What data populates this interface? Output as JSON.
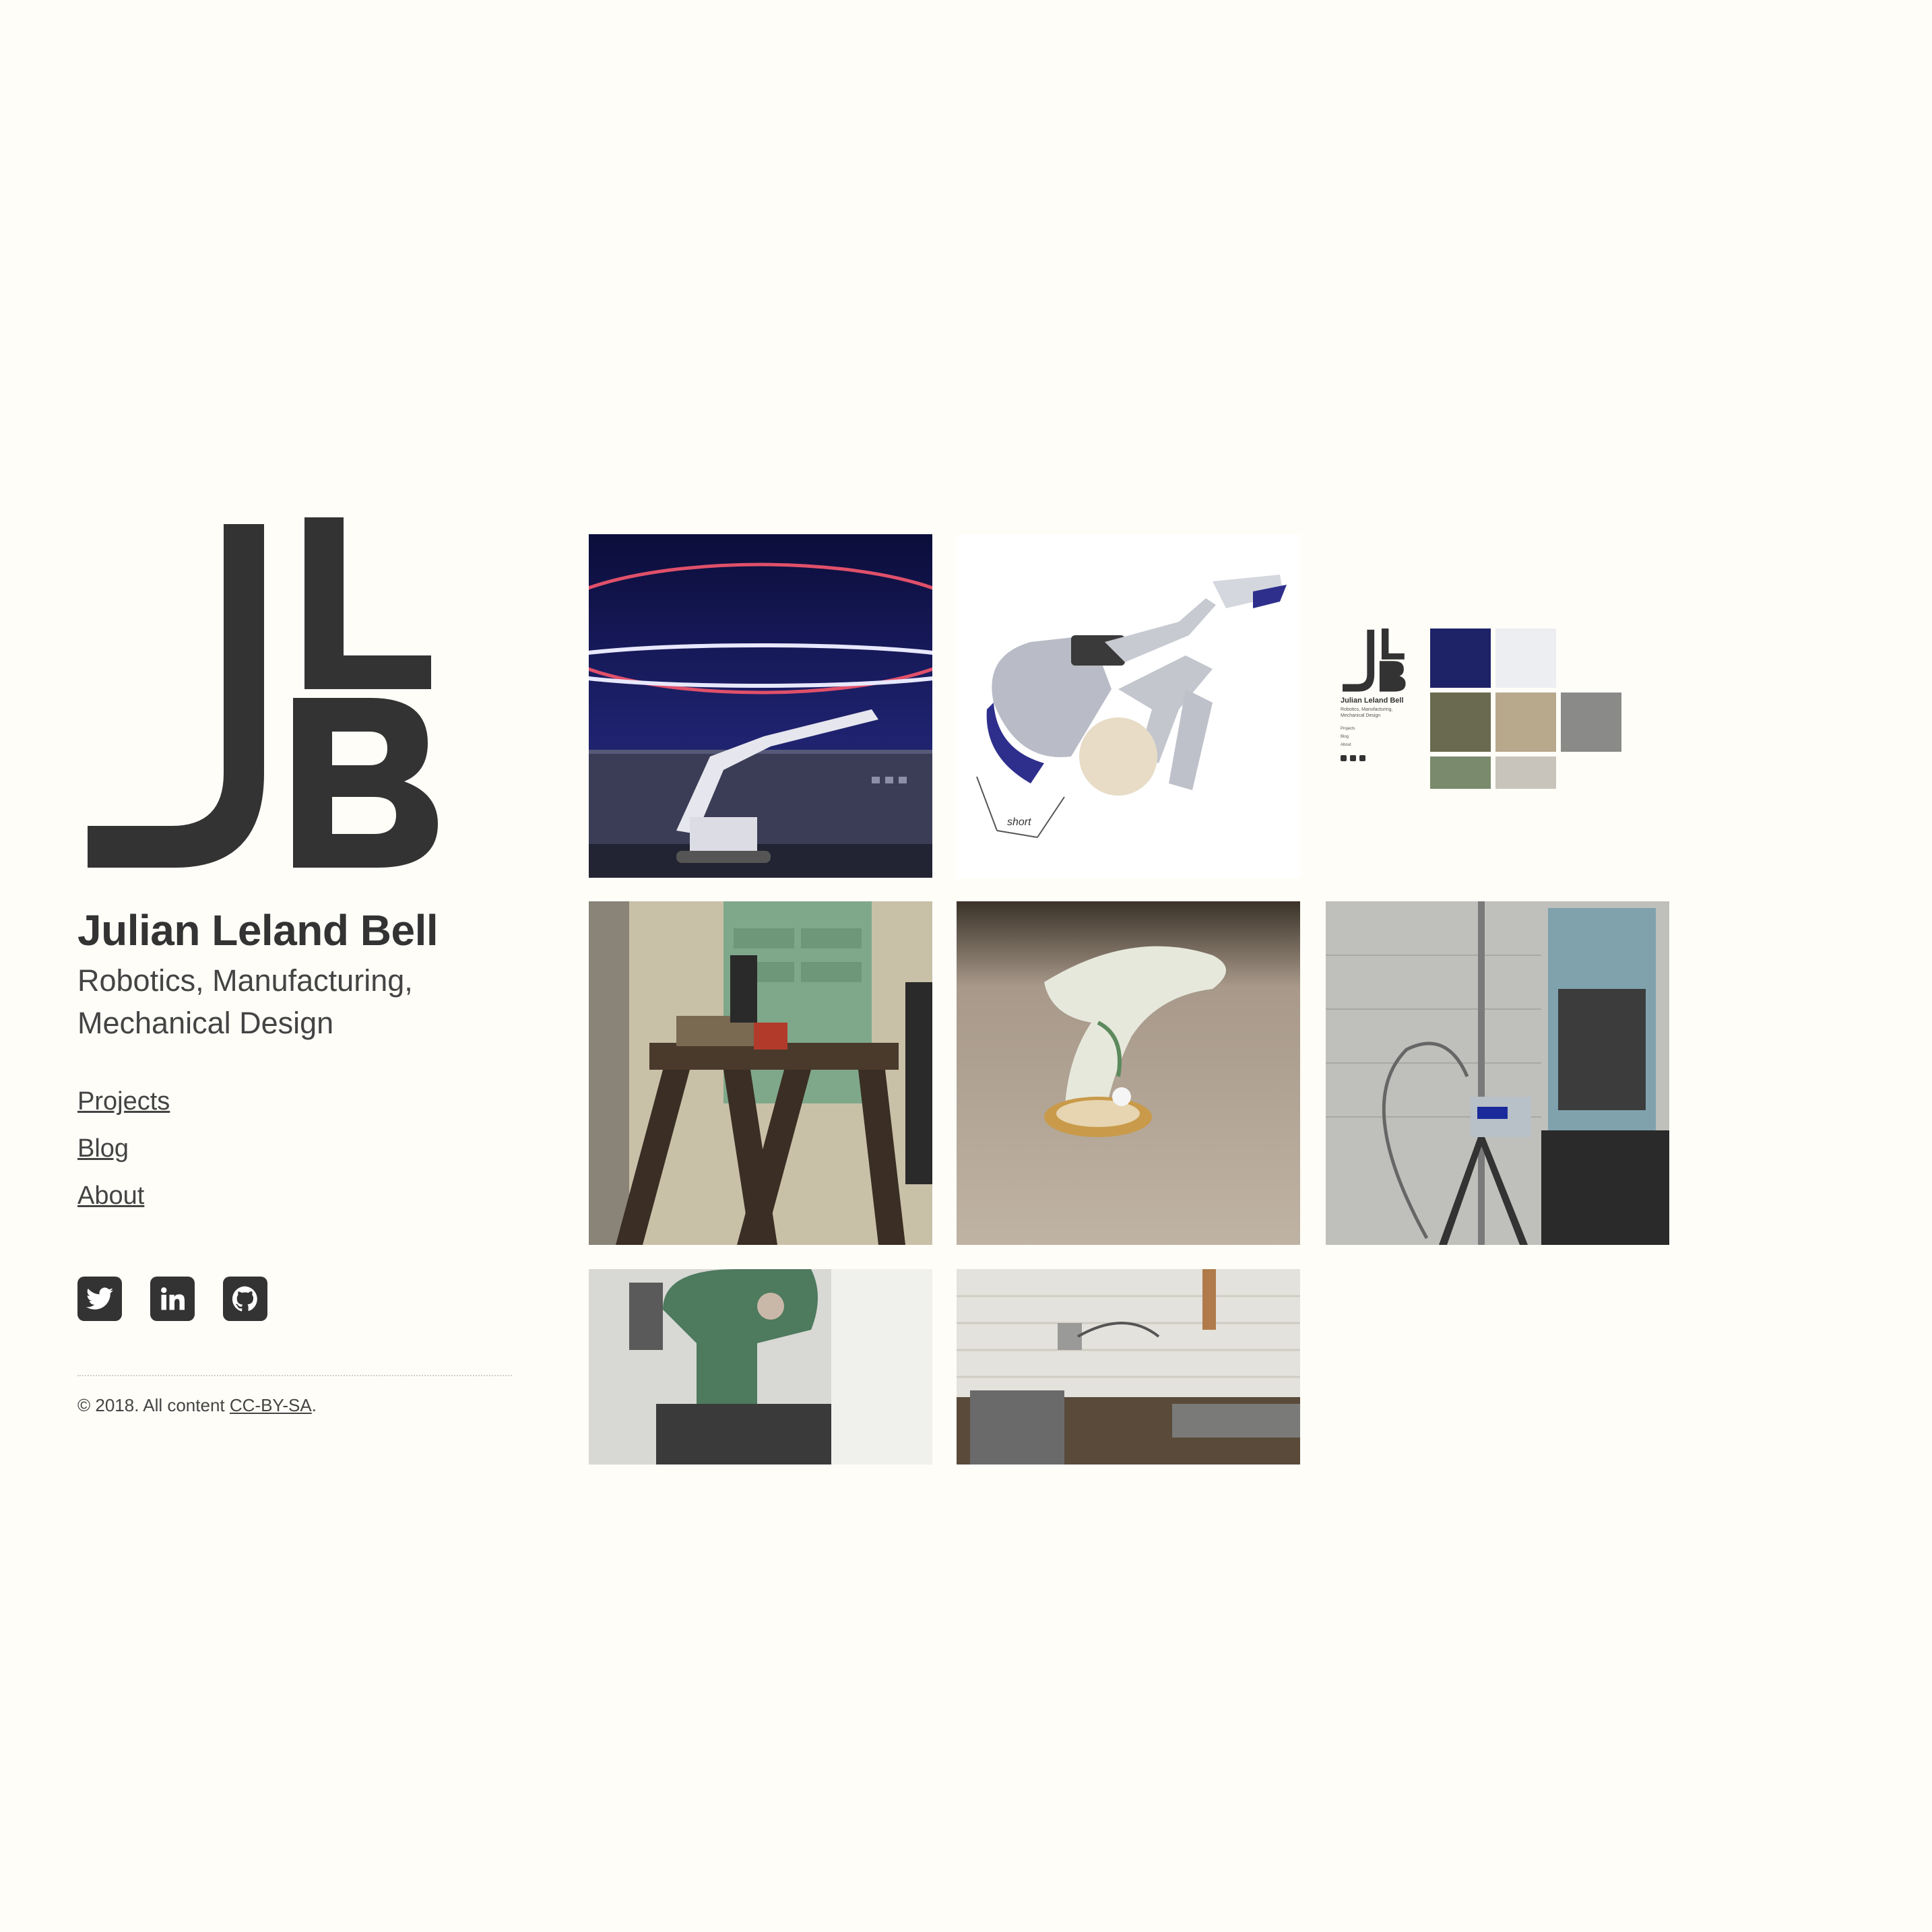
{
  "site": {
    "name": "Julian Leland Bell",
    "tagline_line1": "Robotics, Manufacturing,",
    "tagline_line2": "Mechanical Design"
  },
  "nav": {
    "projects": "Projects",
    "blog": "Blog",
    "about": "About"
  },
  "social": [
    "twitter-icon",
    "linkedin-icon",
    "github-icon"
  ],
  "footer": {
    "prefix": "© 2018. All content ",
    "license": "CC-BY-SA",
    "suffix": "."
  },
  "gallery": {
    "tiles": [
      {
        "name": "project-tile-light-painting-robot"
      },
      {
        "name": "project-tile-robotic-gripper"
      },
      {
        "name": "project-tile-website-screenshot",
        "label": "short"
      },
      {
        "name": "project-tile-steel-frame"
      },
      {
        "name": "project-tile-rings"
      },
      {
        "name": "project-tile-sensor-tripod"
      },
      {
        "name": "project-tile-milling-machine"
      },
      {
        "name": "project-tile-lathe"
      }
    ],
    "gripper_annotation": "short"
  },
  "mini_preview": {
    "name": "Julian Leland Bell",
    "tagline1": "Robotics, Manufacturing,",
    "tagline2": "Mechanical Design",
    "nav": [
      "Projects",
      "Blog",
      "About"
    ]
  },
  "colors": {
    "background": "#fefdf8",
    "text": "#333333",
    "icon_bg": "#333333"
  }
}
